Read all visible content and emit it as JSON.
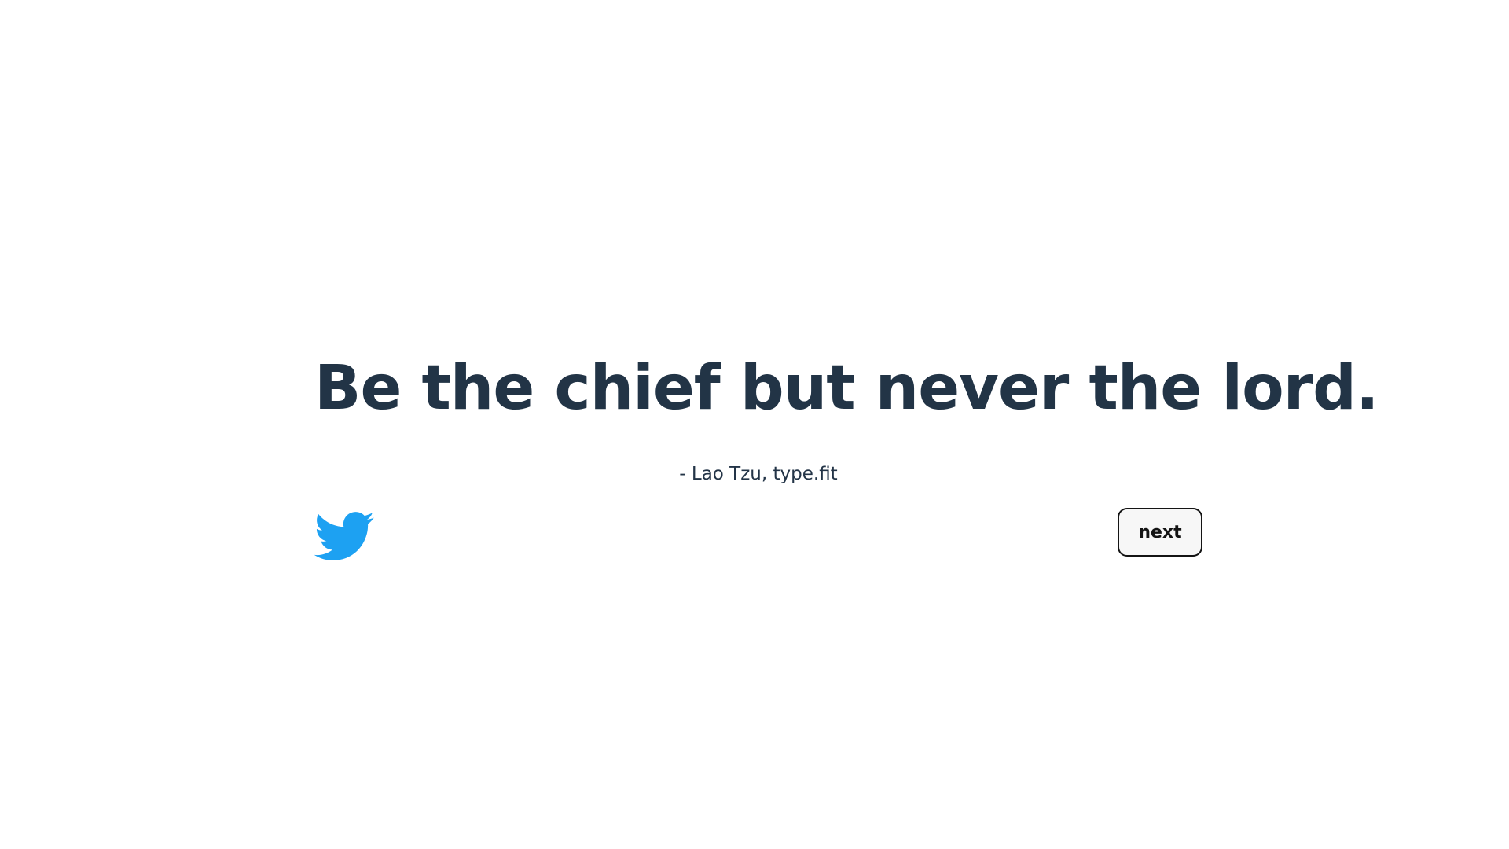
{
  "quote": {
    "text": "Be the chief but never the lord.",
    "attribution": "- Lao Tzu, type.fit"
  },
  "actions": {
    "twitter_icon": "twitter-bird-icon",
    "next_label": "next"
  },
  "colors": {
    "text": "#223446",
    "twitter_blue": "#1DA1F2",
    "button_border": "#141414",
    "button_bg": "#F7F7F7",
    "background": "#FFFFFF"
  }
}
